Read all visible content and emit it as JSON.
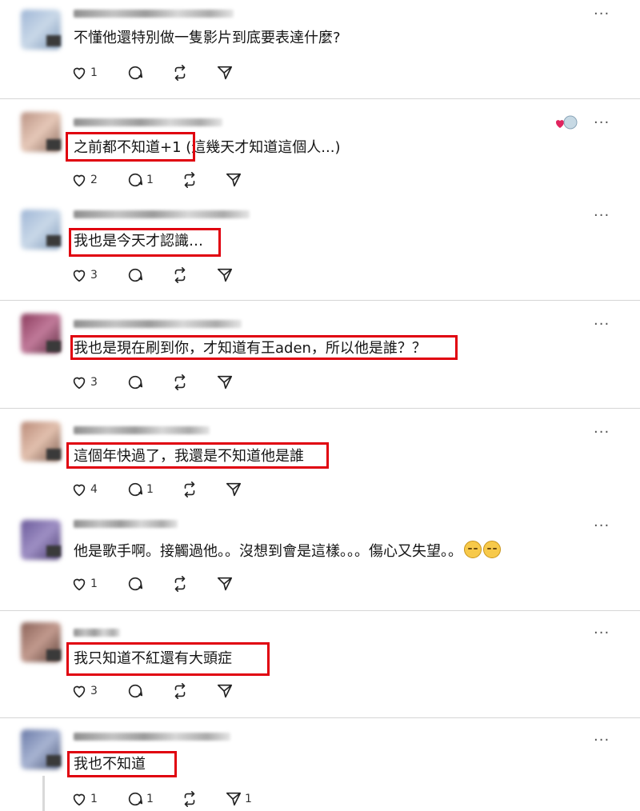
{
  "comments": [
    {
      "text": "不懂他還特別做一隻影片到底要表達什麼?",
      "likes": "1",
      "replies": "",
      "reposts": "",
      "shares": ""
    },
    {
      "text": "之前都不知道+1 (這幾天才知道這個人...)",
      "likes": "2",
      "replies": "1",
      "reposts": "",
      "shares": ""
    },
    {
      "text": "我也是今天才認識…",
      "likes": "3",
      "replies": "",
      "reposts": "",
      "shares": ""
    },
    {
      "text": "我也是現在刷到你，才知道有王aden，所以他是誰？？",
      "likes": "3",
      "replies": "",
      "reposts": "",
      "shares": ""
    },
    {
      "text": "這個年快過了，我還是不知道他是誰",
      "likes": "4",
      "replies": "1",
      "reposts": "",
      "shares": ""
    },
    {
      "text": "他是歌手啊。接觸過他。。沒想到會是這樣。。。傷心又失望。。",
      "likes": "1",
      "replies": "",
      "reposts": "",
      "shares": ""
    },
    {
      "text": "我只知道不紅還有大頭症",
      "likes": "3",
      "replies": "",
      "reposts": "",
      "shares": ""
    },
    {
      "text": "我也不知道",
      "likes": "1",
      "replies": "1",
      "reposts": "",
      "shares": "1"
    }
  ],
  "more_label": "···",
  "colors": {
    "highlight": "#e0000f",
    "separator": "#d6d6d6"
  }
}
